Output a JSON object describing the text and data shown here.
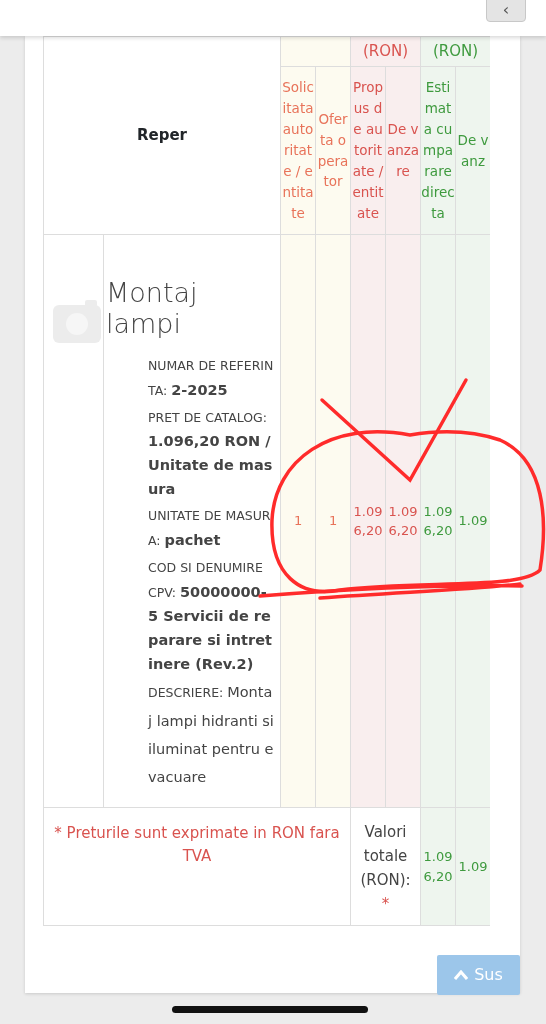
{
  "top_bar": {
    "back_button": "‹"
  },
  "table": {
    "group_headers": [
      {
        "kind": "quantity"
      },
      {
        "kind": "price",
        "label": "(RON)",
        "color": "#d9534f"
      },
      {
        "kind": "estimate",
        "label": "(RON)",
        "color": "#3e9a3e"
      }
    ],
    "reper_header": "Reper",
    "columns": [
      {
        "label": "Solicitata autoritate / entitate",
        "kind": "quantity",
        "color": "#e8735a"
      },
      {
        "label": "Oferta operator",
        "kind": "quantity",
        "color": "#e8735a"
      },
      {
        "label": "Propus de autoritate / entitate",
        "kind": "price",
        "color": "#d9534f"
      },
      {
        "label": "De vanzare",
        "kind": "price",
        "color": "#d9534f"
      },
      {
        "label": "Estimata cumparare directa",
        "kind": "estimate",
        "color": "#3e9a3e"
      },
      {
        "label": "De vanz",
        "kind": "estimate",
        "color": "#3e9a3e"
      }
    ],
    "rows": [
      {
        "title": "Montaj lampi",
        "details": [
          {
            "label": "NUMAR DE REFERINTA:",
            "value": "2-2025",
            "kind": "field"
          },
          {
            "label": "PRET DE CATALOG:",
            "value": "1.096,20  RON / Unitate de masura",
            "kind": "field"
          },
          {
            "label": "UNITATE DE MASURA:",
            "value": "pachet",
            "kind": "field"
          },
          {
            "label": "COD SI DENUMIRE CPV:",
            "value": "50000000-5 Servicii de reparare si intretinere (Rev.2)",
            "kind": "field"
          },
          {
            "label": "DESCRIERE:",
            "value": "Montaj lampi hidranti si iluminat pentru evacuare",
            "kind": "description"
          }
        ],
        "values": [
          "1",
          "1",
          "1.096,20",
          "1.096,20",
          "1.096,20",
          "1.09"
        ]
      }
    ],
    "footer": {
      "note": "* Preturile sunt exprimate in RON fara TVA",
      "totals_label": "Valori totale (RON):",
      "totals_mark": "*",
      "totals": [
        "1.096,20",
        "1.09"
      ]
    }
  },
  "scroll_top_button": {
    "label": "Sus"
  }
}
